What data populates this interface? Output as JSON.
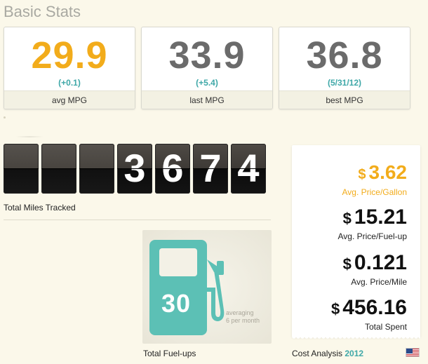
{
  "header": {
    "title": "Basic Stats"
  },
  "stats": [
    {
      "value": "29.9",
      "delta": "(+0.1)",
      "label": "avg MPG"
    },
    {
      "value": "33.9",
      "delta": "(+5.4)",
      "label": "last MPG"
    },
    {
      "value": "36.8",
      "delta": "(5/31/12)",
      "label": "best MPG"
    }
  ],
  "odometer": {
    "digits": [
      "",
      "",
      "",
      "3",
      "6",
      "7",
      "4"
    ],
    "label": "Total Miles Tracked"
  },
  "fuelups": {
    "count": "30",
    "note_line1": "averaging",
    "note_line2": "6 per month",
    "label": "Total Fuel-ups",
    "pump_color": "#5cc0b5"
  },
  "cost": {
    "currency": "$",
    "items": [
      {
        "value": "3.62",
        "label": "Avg. Price/Gallon"
      },
      {
        "value": "15.21",
        "label": "Avg. Price/Fuel-up"
      },
      {
        "value": "0.121",
        "label": "Avg. Price/Mile"
      },
      {
        "value": "456.16",
        "label": "Total Spent"
      }
    ],
    "footer_label": "Cost Analysis",
    "footer_year": "2012",
    "flag_icon": "us-flag-icon"
  },
  "colors": {
    "accent": "#f2ac1b",
    "teal": "#3fa8a8",
    "background": "#fbf8ea"
  }
}
